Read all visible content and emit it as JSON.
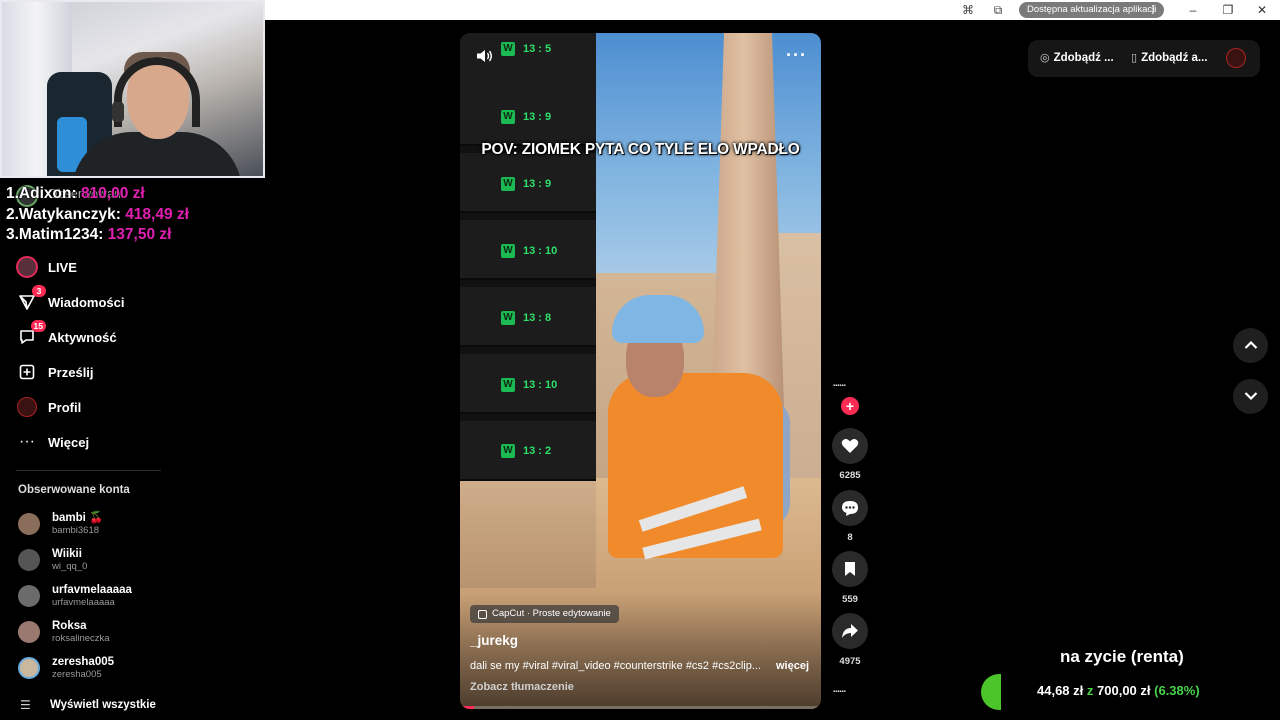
{
  "titlebar": {
    "update_text": "Dostępna aktualizacja aplikacji",
    "update_dots": "⋮"
  },
  "leaderboard": [
    {
      "name": "1.Adixon:",
      "amount": "810,00 zł"
    },
    {
      "name": "2.Watykanczyk:",
      "amount": "418,49 zł"
    },
    {
      "name": "3.Matim1234:",
      "amount": "137,50 zł"
    }
  ],
  "sidebar": {
    "ghost_label": "Obserwowani",
    "nav": [
      {
        "label": "LIVE",
        "icon": "live-icon"
      },
      {
        "label": "Wiadomości",
        "icon": "message-icon",
        "badge": "3"
      },
      {
        "label": "Aktywność",
        "icon": "activity-icon",
        "badge": "15"
      },
      {
        "label": "Prześlij",
        "icon": "upload-icon"
      },
      {
        "label": "Profil",
        "icon": "profile-icon"
      },
      {
        "label": "Więcej",
        "icon": "more-icon"
      }
    ],
    "section_title": "Obserwowane konta",
    "accounts": [
      {
        "name": "bambi 🍒",
        "handle": "bambi3618",
        "color": "#8a6d5a"
      },
      {
        "name": "Wiikii",
        "handle": "wi_qq_0",
        "color": "#555555"
      },
      {
        "name": "urfavmelaaaaa",
        "handle": "urfavmelaaaaa",
        "color": "#6b6b6b"
      },
      {
        "name": "Roksa",
        "handle": "roksalineczka",
        "color": "#9a7a70"
      },
      {
        "name": "zeresha005",
        "handle": "zeresha005",
        "color": "#c9b79e"
      }
    ],
    "show_all": "Wyświetl wszystkie"
  },
  "video": {
    "caption": "POV: ZIOMEK PYTA CO TYLE ELO WPADŁO",
    "scores": [
      {
        "w": "W",
        "score": "13 : 5"
      },
      {
        "w": "W",
        "score": "13 : 9"
      },
      {
        "w": "W",
        "score": "13 : 9"
      },
      {
        "w": "W",
        "score": "13 : 10"
      },
      {
        "w": "W",
        "score": "13 : 8"
      },
      {
        "w": "W",
        "score": "13 : 10"
      },
      {
        "w": "W",
        "score": "13 : 2"
      }
    ],
    "capcut": "CapCut · Proste edytowanie",
    "author": "_jurekg",
    "description": "dali se my #viral #viral_video #counterstrike #cs2 #cs2clip...",
    "more": "więcej",
    "translate": "Zobacz tłumaczenie",
    "progress": 0.04
  },
  "actions": {
    "likes": "6285",
    "comments": "8",
    "saves": "559",
    "shares": "4975"
  },
  "top_right": {
    "item1": "Zdobądź ...",
    "item2": "Zdobądź a..."
  },
  "goal": {
    "title": "na zycie (renta)",
    "current": "44,68 zł",
    "z": "z",
    "target": "700,00 zł",
    "percent": "(6.38%)"
  },
  "colors": {
    "accent": "#fe2c55",
    "donation": "#e020b0",
    "score_green": "#2ee06a",
    "goal_green": "#49d24b"
  }
}
